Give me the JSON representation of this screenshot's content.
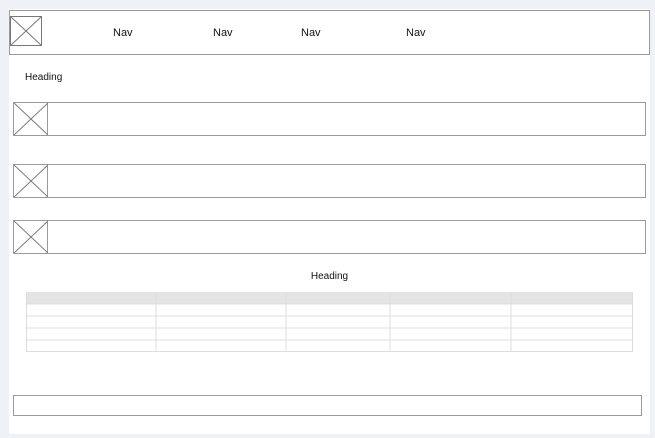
{
  "header": {
    "logo_icon": "image-placeholder-icon",
    "nav": [
      {
        "label": "Nav"
      },
      {
        "label": "Nav"
      },
      {
        "label": "Nav"
      },
      {
        "label": "Nav"
      }
    ]
  },
  "section1": {
    "heading": "Heading",
    "rows": [
      {
        "thumb_icon": "image-placeholder-icon"
      },
      {
        "thumb_icon": "image-placeholder-icon"
      },
      {
        "thumb_icon": "image-placeholder-icon"
      }
    ]
  },
  "section2": {
    "heading": "Heading",
    "table": {
      "columns": [
        "",
        "",
        "",
        "",
        ""
      ],
      "rows": [
        [
          "",
          "",
          "",
          "",
          ""
        ],
        [
          "",
          "",
          "",
          "",
          ""
        ],
        [
          "",
          "",
          "",
          "",
          ""
        ],
        [
          "",
          "",
          "",
          "",
          ""
        ]
      ]
    }
  },
  "colors": {
    "border": "#9a9a9a",
    "table_header": "#e4e4e4",
    "table_line": "#dddddd",
    "background": "#eef2f7"
  }
}
